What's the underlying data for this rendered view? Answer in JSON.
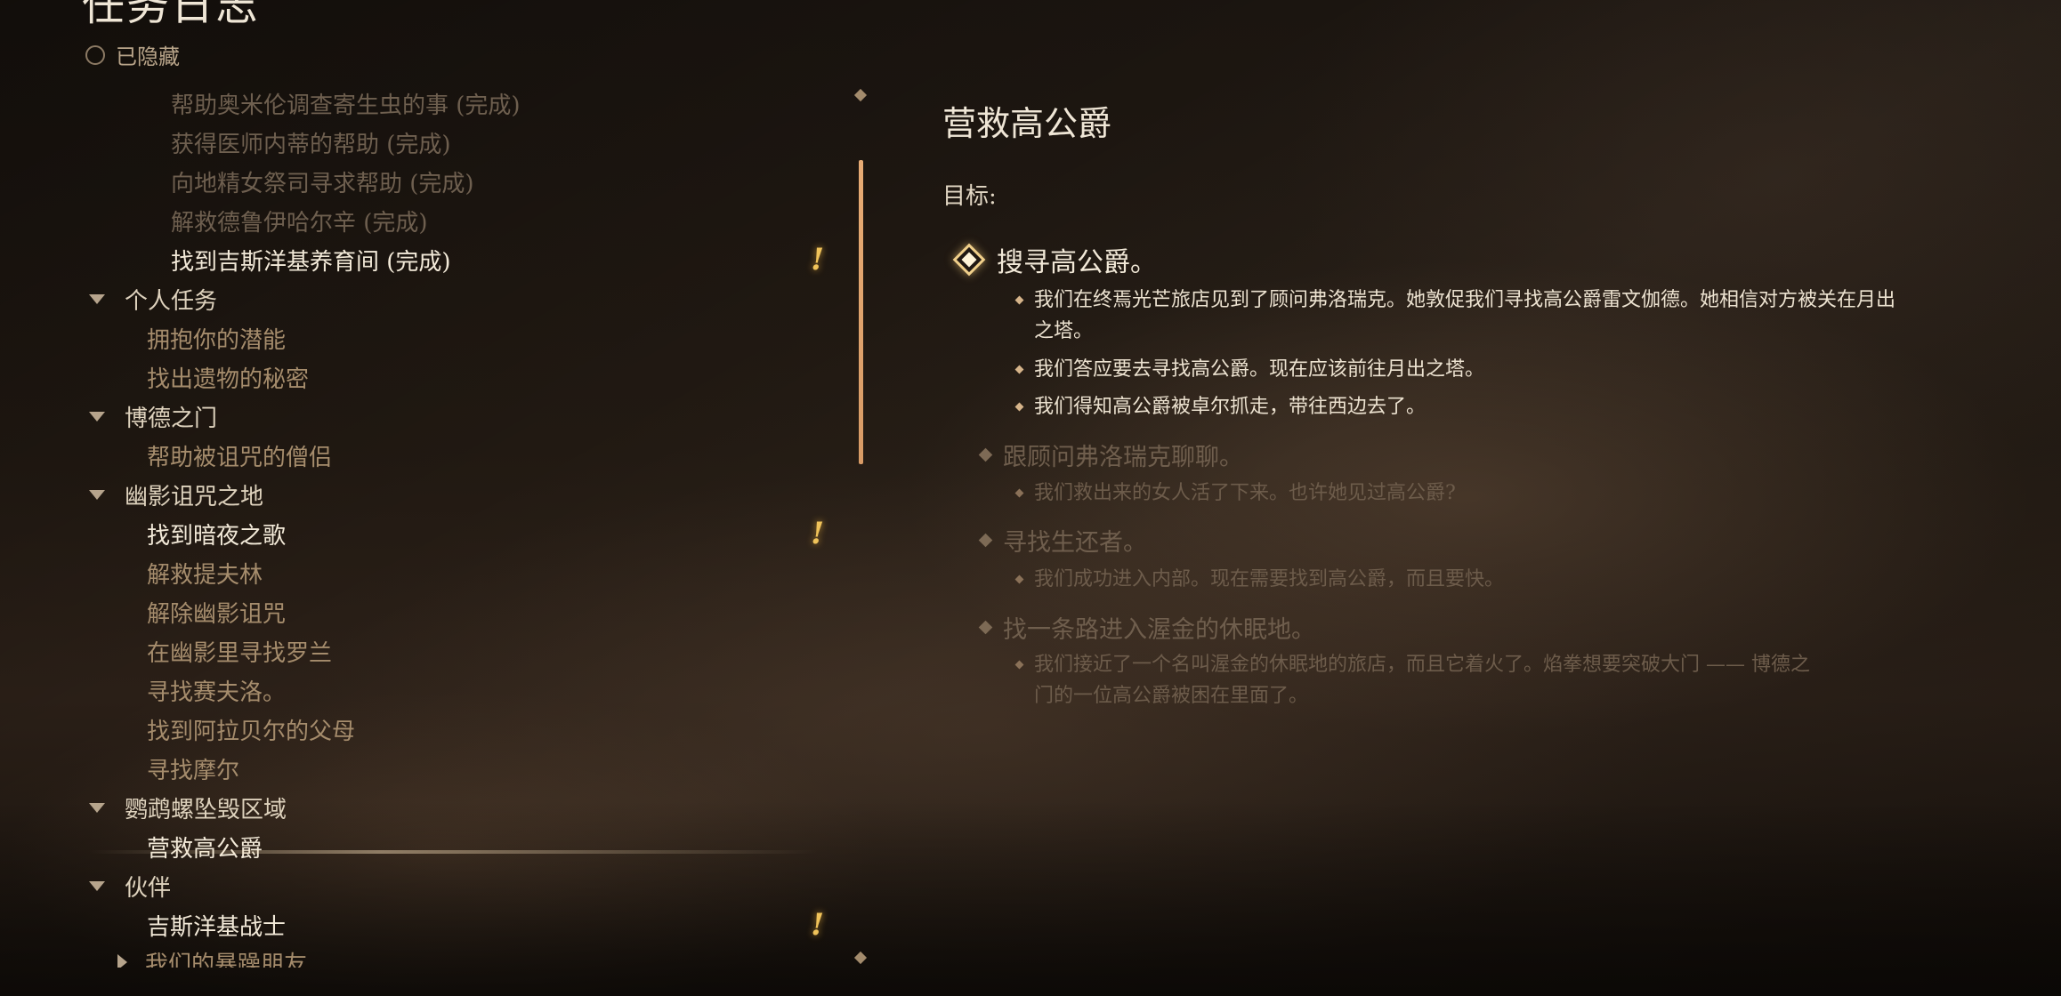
{
  "header": {
    "title": "任务日志",
    "hidden_toggle_label": "已隐藏"
  },
  "quest_list": [
    {
      "label": "帮助奥米伦调查寄生虫的事 (完成)",
      "state": "done",
      "level": 2
    },
    {
      "label": "获得医师内蒂的帮助 (完成)",
      "state": "done",
      "level": 2
    },
    {
      "label": "向地精女祭司寻求帮助 (完成)",
      "state": "done",
      "level": 2
    },
    {
      "label": "解救德鲁伊哈尔辛 (完成)",
      "state": "done",
      "level": 2
    },
    {
      "label": "找到吉斯洋基养育间 (完成)",
      "state": "active",
      "level": 2,
      "alert": "!"
    },
    {
      "label": "个人任务",
      "state": "category",
      "level": 0
    },
    {
      "label": "拥抱你的潜能",
      "state": "quest",
      "level": 1
    },
    {
      "label": "找出遗物的秘密",
      "state": "quest",
      "level": 1
    },
    {
      "label": "博德之门",
      "state": "category",
      "level": 0
    },
    {
      "label": "帮助被诅咒的僧侣",
      "state": "quest",
      "level": 1
    },
    {
      "label": "幽影诅咒之地",
      "state": "category",
      "level": 0
    },
    {
      "label": "找到暗夜之歌",
      "state": "active",
      "level": 1,
      "alert": "!"
    },
    {
      "label": "解救提夫林",
      "state": "quest",
      "level": 1
    },
    {
      "label": "解除幽影诅咒",
      "state": "quest",
      "level": 1
    },
    {
      "label": "在幽影里寻找罗兰",
      "state": "quest",
      "level": 1
    },
    {
      "label": "寻找赛夫洛。",
      "state": "quest",
      "level": 1
    },
    {
      "label": "找到阿拉贝尔的父母",
      "state": "quest",
      "level": 1
    },
    {
      "label": "寻找摩尔",
      "state": "quest",
      "level": 1
    },
    {
      "label": "鹦鹉螺坠毁区域",
      "state": "category",
      "level": 0
    },
    {
      "label": "营救高公爵",
      "state": "active",
      "level": 1,
      "selected": true
    },
    {
      "label": "伙伴",
      "state": "category",
      "level": 0
    },
    {
      "label": "吉斯洋基战士",
      "state": "active",
      "level": 1,
      "alert": "!"
    },
    {
      "label": "我们的暴躁朋友",
      "state": "collapsed",
      "level": 1
    }
  ],
  "detail": {
    "title": "营救高公爵",
    "objectives_label": "目标:",
    "objectives": [
      {
        "title": "搜寻高公爵。",
        "status": "current",
        "entries": [
          "我们在终焉光芒旅店见到了顾问弗洛瑞克。她敦促我们寻找高公爵雷文伽德。她相信对方被关在月出之塔。",
          "我们答应要去寻找高公爵。现在应该前往月出之塔。",
          "我们得知高公爵被卓尔抓走，带往西边去了。"
        ]
      },
      {
        "title": "跟顾问弗洛瑞克聊聊。",
        "status": "past",
        "entries": [
          "我们救出来的女人活了下来。也许她见过高公爵?"
        ]
      },
      {
        "title": "寻找生还者。",
        "status": "past",
        "entries": [
          "我们成功进入内部。现在需要找到高公爵，而且要快。"
        ]
      },
      {
        "title": "找一条路进入渥金的休眠地。",
        "status": "past",
        "entries": [
          "我们接近了一个名叫渥金的休眠地的旅店，而且它着火了。焰拳想要突破大门 —— 博德之门的一位高公爵被困在里面了。"
        ]
      }
    ]
  },
  "colors": {
    "accent_scroll": "#e7ab74",
    "alert": "#f0c35a",
    "done_text": "#6e5f4f",
    "quest_text": "#a58c6c",
    "active_text": "#f3ead9"
  }
}
